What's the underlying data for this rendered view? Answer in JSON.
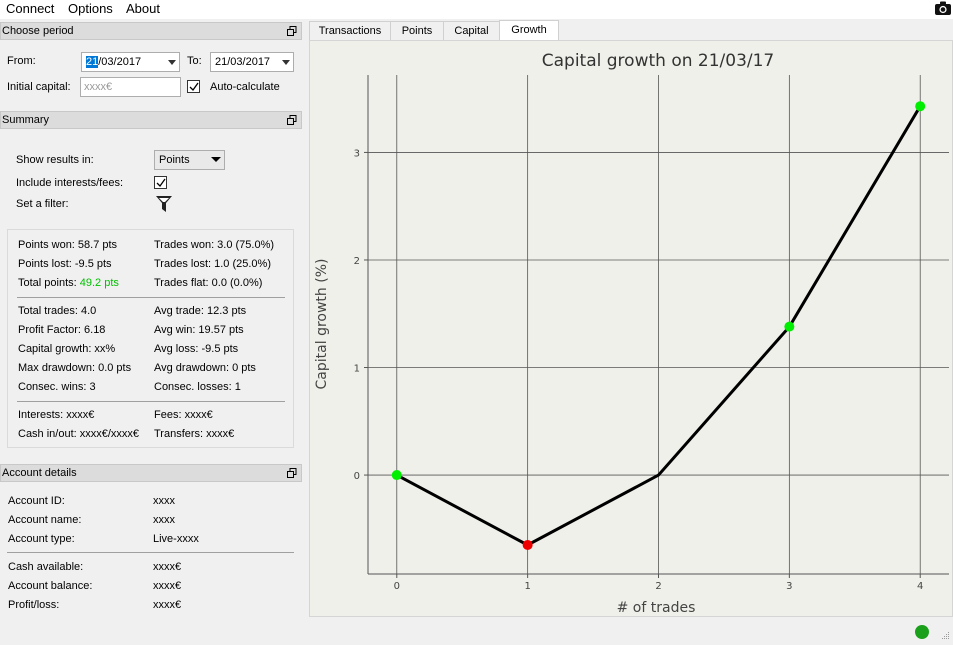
{
  "menu": {
    "connect": "Connect",
    "options": "Options",
    "about": "About"
  },
  "period": {
    "title": "Choose period",
    "from_label": "From:",
    "from_day": "21",
    "from_rest": "/03/2017",
    "to_label": "To:",
    "to_value": "21/03/2017",
    "initial_capital_label": "Initial capital:",
    "initial_capital_placeholder": "xxxx€",
    "auto_calculate_label": "Auto-calculate"
  },
  "summary": {
    "title": "Summary",
    "show_results_label": "Show results in:",
    "show_results_value": "Points",
    "include_fees_label": "Include interests/fees:",
    "filter_label": "Set a filter:",
    "stats": {
      "points_won": "Points won: 58.7 pts",
      "points_lost": "Points lost: -9.5 pts",
      "total_points_label": "Total points: ",
      "total_points_value": "49.2 pts",
      "trades_won": "Trades won: 3.0 (75.0%)",
      "trades_lost": "Trades lost: 1.0 (25.0%)",
      "trades_flat": "Trades flat: 0.0 (0.0%)",
      "total_trades": "Total trades: 4.0",
      "profit_factor": "Profit Factor: 6.18",
      "capital_growth": "Capital growth: xx%",
      "max_drawdown": "Max drawdown: 0.0 pts",
      "consec_wins": "Consec. wins: 3",
      "avg_trade": "Avg trade: 12.3 pts",
      "avg_win": "Avg win: 19.57 pts",
      "avg_loss": "Avg loss: -9.5 pts",
      "avg_drawdown": "Avg drawdown: 0 pts",
      "consec_losses": "Consec. losses: 1",
      "interests": "Interests: xxxx€",
      "cash_in_out": "Cash in/out: xxxx€/xxxx€",
      "fees": "Fees: xxxx€",
      "transfers": "Transfers: xxxx€"
    }
  },
  "account": {
    "title": "Account details",
    "rows": [
      {
        "label": "Account ID:",
        "value": "xxxx"
      },
      {
        "label": "Account name:",
        "value": "xxxx"
      },
      {
        "label": "Account type:",
        "value": "Live-xxxx"
      },
      {
        "label": "Cash available:",
        "value": "xxxx€"
      },
      {
        "label": "Account balance:",
        "value": "xxxx€"
      },
      {
        "label": "Profit/loss:",
        "value": "xxxx€"
      }
    ]
  },
  "tabs": [
    {
      "label": "Transactions"
    },
    {
      "label": "Points"
    },
    {
      "label": "Capital"
    },
    {
      "label": "Growth",
      "active": true
    }
  ],
  "chart_data": {
    "type": "line",
    "title": "Capital growth on 21/03/17",
    "xlabel": "# of trades",
    "ylabel": "Capital growth (%)",
    "x": [
      0,
      1,
      2,
      3,
      4
    ],
    "values": [
      0,
      -0.65,
      0,
      1.38,
      3.43
    ],
    "point_colors": [
      "#00ee00",
      "#ee0000",
      null,
      "#00ee00",
      "#00ee00"
    ],
    "xlim": [
      -0.22,
      4.22
    ],
    "ylim": [
      -0.92,
      3.72
    ],
    "xticks": [
      0,
      1,
      2,
      3,
      4
    ],
    "yticks": [
      0,
      1,
      2,
      3
    ],
    "grid": true,
    "line_color": "#000000",
    "background": "#f0f0ea"
  },
  "status": {
    "connected_color": "#1aa01a"
  }
}
